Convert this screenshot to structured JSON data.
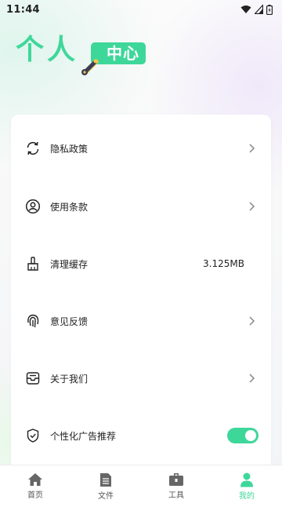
{
  "status_bar": {
    "time": "11:44",
    "icons": [
      "wifi-icon",
      "signal-icon",
      "battery-icon"
    ]
  },
  "header": {
    "title": "个人",
    "badge": "中心",
    "accent_color": "#3ed79a"
  },
  "menu": {
    "items": [
      {
        "label": "隐私政策",
        "icon": "refresh-icon",
        "trailing": "chevron"
      },
      {
        "label": "使用条款",
        "icon": "user-circle-icon",
        "trailing": "chevron"
      },
      {
        "label": "清理缓存",
        "icon": "broom-icon",
        "trailing": "value",
        "value": "3.125MB"
      },
      {
        "label": "意见反馈",
        "icon": "fingerprint-icon",
        "trailing": "chevron"
      },
      {
        "label": "关于我们",
        "icon": "inbox-icon",
        "trailing": "chevron"
      },
      {
        "label": "个性化广告推荐",
        "icon": "shield-check-icon",
        "trailing": "toggle",
        "enabled": true
      }
    ]
  },
  "tabbar": {
    "tabs": [
      {
        "label": "首页",
        "icon": "home-icon",
        "active": false
      },
      {
        "label": "文件",
        "icon": "file-icon",
        "active": false
      },
      {
        "label": "工具",
        "icon": "toolbox-icon",
        "active": false
      },
      {
        "label": "我的",
        "icon": "person-icon",
        "active": true
      }
    ]
  }
}
